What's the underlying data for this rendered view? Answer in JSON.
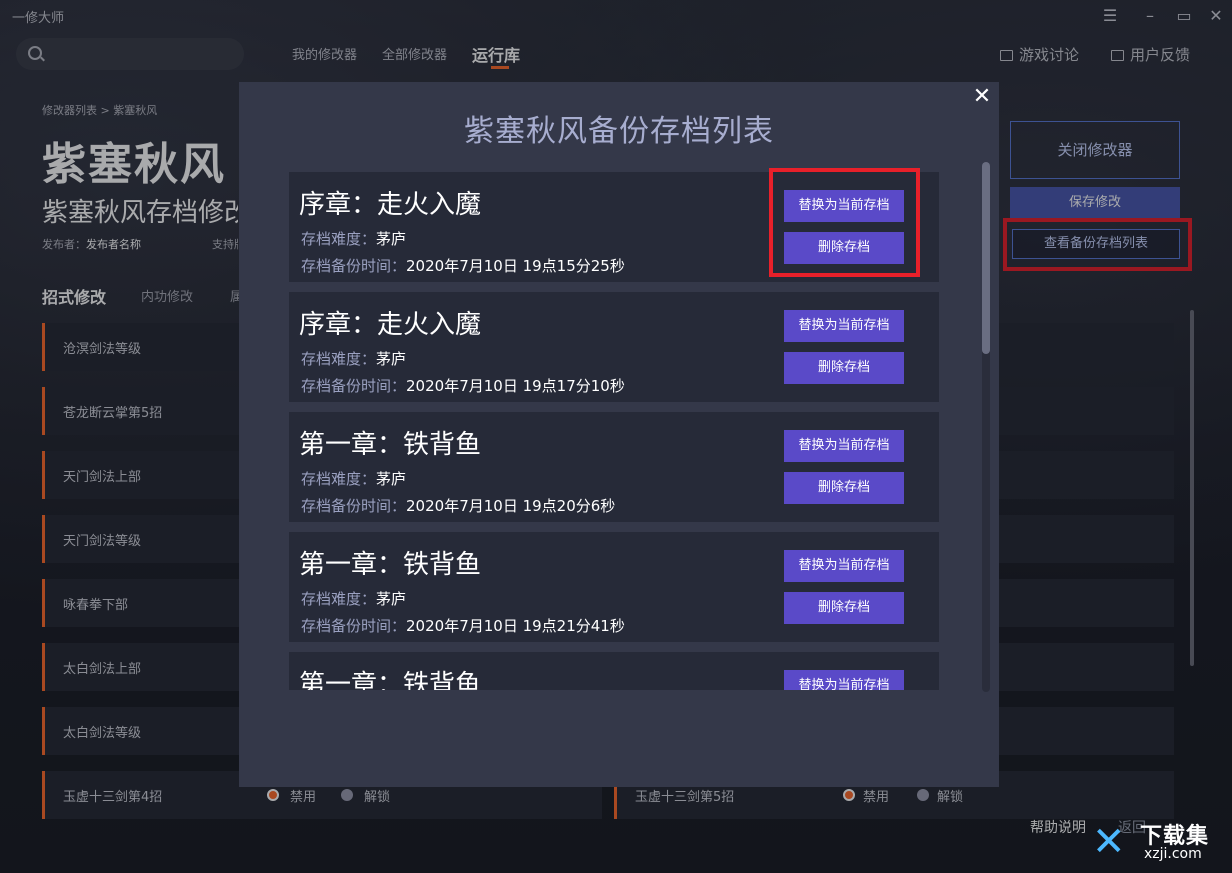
{
  "app": {
    "title": "一修大师"
  },
  "search": {
    "placeholder": ""
  },
  "nav": {
    "tabs": [
      "我的修改器",
      "全部修改器",
      "运行库"
    ],
    "active": 2
  },
  "top_links": {
    "discussion": "游戏讨论",
    "feedback": "用户反馈"
  },
  "breadcrumb": "修改器列表 > 紫塞秋风",
  "game": {
    "title": "紫塞秋风",
    "subtitle": "紫塞秋风存档修改器",
    "publisher_label": "发布者：",
    "publisher_value": "发布者名称",
    "support_label": "支持版本"
  },
  "categories": {
    "tabs": [
      "招式修改",
      "内功修改",
      "属性修改"
    ],
    "active": 0
  },
  "rows_left": [
    "沧溟剑法等级",
    "苍龙断云掌第5招",
    "天门剑法上部",
    "天门剑法等级",
    "咏春拳下部",
    "太白剑法上部",
    "太白剑法等级",
    "玉虚十三剑第4招"
  ],
  "rows_right_last": "玉虚十三剑第5招",
  "radio": {
    "disable": "禁用",
    "unlock": "解锁"
  },
  "right_panel": {
    "close_modifier": "关闭修改器",
    "save": "保存修改",
    "view_backups": "查看备份存档列表"
  },
  "footer": {
    "help": "帮助说明",
    "back": "返回",
    "home": "页"
  },
  "watermark": {
    "brand": "下载集",
    "url": "xzji.com"
  },
  "modal": {
    "title": "紫塞秋风备份存档列表",
    "difficulty_label": "存档难度：",
    "time_label": "存档备份时间：",
    "replace_label": "替换为当前存档",
    "delete_label": "删除存档",
    "items": [
      {
        "chapter": "序章：走火入魔",
        "difficulty": "茅庐",
        "time": "2020年7月10日 19点15分25秒"
      },
      {
        "chapter": "序章：走火入魔",
        "difficulty": "茅庐",
        "time": "2020年7月10日 19点17分10秒"
      },
      {
        "chapter": "第一章：铁背鱼",
        "difficulty": "茅庐",
        "time": "2020年7月10日 19点20分6秒"
      },
      {
        "chapter": "第一章：铁背鱼",
        "difficulty": "茅庐",
        "time": "2020年7月10日 19点21分41秒"
      },
      {
        "chapter": "第一章：铁背鱼",
        "difficulty": "茅庐",
        "time": ""
      }
    ]
  },
  "colors": {
    "accent": "#ff6a2a",
    "button": "#5a4ac8",
    "highlight": "#e8202a",
    "modal_bg": "#343849"
  }
}
